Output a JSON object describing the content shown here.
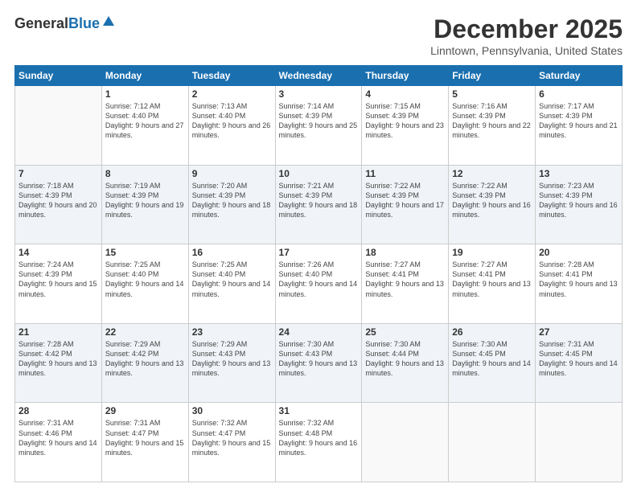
{
  "header": {
    "logo_general": "General",
    "logo_blue": "Blue",
    "month_title": "December 2025",
    "location": "Linntown, Pennsylvania, United States"
  },
  "weekdays": [
    "Sunday",
    "Monday",
    "Tuesday",
    "Wednesday",
    "Thursday",
    "Friday",
    "Saturday"
  ],
  "weeks": [
    [
      {
        "day": "",
        "sunrise": "",
        "sunset": "",
        "daylight": ""
      },
      {
        "day": "1",
        "sunrise": "Sunrise: 7:12 AM",
        "sunset": "Sunset: 4:40 PM",
        "daylight": "Daylight: 9 hours and 27 minutes."
      },
      {
        "day": "2",
        "sunrise": "Sunrise: 7:13 AM",
        "sunset": "Sunset: 4:40 PM",
        "daylight": "Daylight: 9 hours and 26 minutes."
      },
      {
        "day": "3",
        "sunrise": "Sunrise: 7:14 AM",
        "sunset": "Sunset: 4:39 PM",
        "daylight": "Daylight: 9 hours and 25 minutes."
      },
      {
        "day": "4",
        "sunrise": "Sunrise: 7:15 AM",
        "sunset": "Sunset: 4:39 PM",
        "daylight": "Daylight: 9 hours and 23 minutes."
      },
      {
        "day": "5",
        "sunrise": "Sunrise: 7:16 AM",
        "sunset": "Sunset: 4:39 PM",
        "daylight": "Daylight: 9 hours and 22 minutes."
      },
      {
        "day": "6",
        "sunrise": "Sunrise: 7:17 AM",
        "sunset": "Sunset: 4:39 PM",
        "daylight": "Daylight: 9 hours and 21 minutes."
      }
    ],
    [
      {
        "day": "7",
        "sunrise": "Sunrise: 7:18 AM",
        "sunset": "Sunset: 4:39 PM",
        "daylight": "Daylight: 9 hours and 20 minutes."
      },
      {
        "day": "8",
        "sunrise": "Sunrise: 7:19 AM",
        "sunset": "Sunset: 4:39 PM",
        "daylight": "Daylight: 9 hours and 19 minutes."
      },
      {
        "day": "9",
        "sunrise": "Sunrise: 7:20 AM",
        "sunset": "Sunset: 4:39 PM",
        "daylight": "Daylight: 9 hours and 18 minutes."
      },
      {
        "day": "10",
        "sunrise": "Sunrise: 7:21 AM",
        "sunset": "Sunset: 4:39 PM",
        "daylight": "Daylight: 9 hours and 18 minutes."
      },
      {
        "day": "11",
        "sunrise": "Sunrise: 7:22 AM",
        "sunset": "Sunset: 4:39 PM",
        "daylight": "Daylight: 9 hours and 17 minutes."
      },
      {
        "day": "12",
        "sunrise": "Sunrise: 7:22 AM",
        "sunset": "Sunset: 4:39 PM",
        "daylight": "Daylight: 9 hours and 16 minutes."
      },
      {
        "day": "13",
        "sunrise": "Sunrise: 7:23 AM",
        "sunset": "Sunset: 4:39 PM",
        "daylight": "Daylight: 9 hours and 16 minutes."
      }
    ],
    [
      {
        "day": "14",
        "sunrise": "Sunrise: 7:24 AM",
        "sunset": "Sunset: 4:39 PM",
        "daylight": "Daylight: 9 hours and 15 minutes."
      },
      {
        "day": "15",
        "sunrise": "Sunrise: 7:25 AM",
        "sunset": "Sunset: 4:40 PM",
        "daylight": "Daylight: 9 hours and 14 minutes."
      },
      {
        "day": "16",
        "sunrise": "Sunrise: 7:25 AM",
        "sunset": "Sunset: 4:40 PM",
        "daylight": "Daylight: 9 hours and 14 minutes."
      },
      {
        "day": "17",
        "sunrise": "Sunrise: 7:26 AM",
        "sunset": "Sunset: 4:40 PM",
        "daylight": "Daylight: 9 hours and 14 minutes."
      },
      {
        "day": "18",
        "sunrise": "Sunrise: 7:27 AM",
        "sunset": "Sunset: 4:41 PM",
        "daylight": "Daylight: 9 hours and 13 minutes."
      },
      {
        "day": "19",
        "sunrise": "Sunrise: 7:27 AM",
        "sunset": "Sunset: 4:41 PM",
        "daylight": "Daylight: 9 hours and 13 minutes."
      },
      {
        "day": "20",
        "sunrise": "Sunrise: 7:28 AM",
        "sunset": "Sunset: 4:41 PM",
        "daylight": "Daylight: 9 hours and 13 minutes."
      }
    ],
    [
      {
        "day": "21",
        "sunrise": "Sunrise: 7:28 AM",
        "sunset": "Sunset: 4:42 PM",
        "daylight": "Daylight: 9 hours and 13 minutes."
      },
      {
        "day": "22",
        "sunrise": "Sunrise: 7:29 AM",
        "sunset": "Sunset: 4:42 PM",
        "daylight": "Daylight: 9 hours and 13 minutes."
      },
      {
        "day": "23",
        "sunrise": "Sunrise: 7:29 AM",
        "sunset": "Sunset: 4:43 PM",
        "daylight": "Daylight: 9 hours and 13 minutes."
      },
      {
        "day": "24",
        "sunrise": "Sunrise: 7:30 AM",
        "sunset": "Sunset: 4:43 PM",
        "daylight": "Daylight: 9 hours and 13 minutes."
      },
      {
        "day": "25",
        "sunrise": "Sunrise: 7:30 AM",
        "sunset": "Sunset: 4:44 PM",
        "daylight": "Daylight: 9 hours and 13 minutes."
      },
      {
        "day": "26",
        "sunrise": "Sunrise: 7:30 AM",
        "sunset": "Sunset: 4:45 PM",
        "daylight": "Daylight: 9 hours and 14 minutes."
      },
      {
        "day": "27",
        "sunrise": "Sunrise: 7:31 AM",
        "sunset": "Sunset: 4:45 PM",
        "daylight": "Daylight: 9 hours and 14 minutes."
      }
    ],
    [
      {
        "day": "28",
        "sunrise": "Sunrise: 7:31 AM",
        "sunset": "Sunset: 4:46 PM",
        "daylight": "Daylight: 9 hours and 14 minutes."
      },
      {
        "day": "29",
        "sunrise": "Sunrise: 7:31 AM",
        "sunset": "Sunset: 4:47 PM",
        "daylight": "Daylight: 9 hours and 15 minutes."
      },
      {
        "day": "30",
        "sunrise": "Sunrise: 7:32 AM",
        "sunset": "Sunset: 4:47 PM",
        "daylight": "Daylight: 9 hours and 15 minutes."
      },
      {
        "day": "31",
        "sunrise": "Sunrise: 7:32 AM",
        "sunset": "Sunset: 4:48 PM",
        "daylight": "Daylight: 9 hours and 16 minutes."
      },
      {
        "day": "",
        "sunrise": "",
        "sunset": "",
        "daylight": ""
      },
      {
        "day": "",
        "sunrise": "",
        "sunset": "",
        "daylight": ""
      },
      {
        "day": "",
        "sunrise": "",
        "sunset": "",
        "daylight": ""
      }
    ]
  ]
}
